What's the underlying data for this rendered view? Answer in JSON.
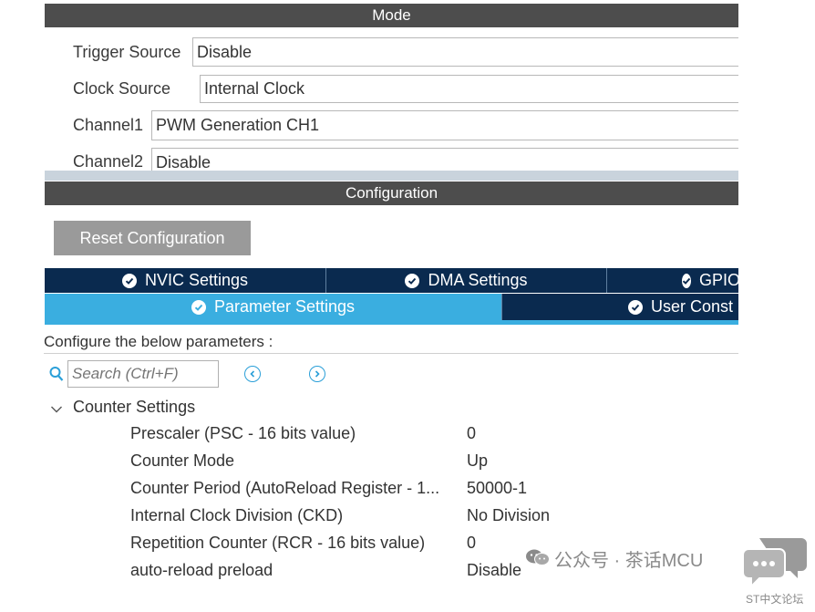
{
  "mode": {
    "title": "Mode",
    "rows": [
      {
        "label": "Trigger Source",
        "value": "Disable"
      },
      {
        "label": "Clock Source",
        "value": "Internal Clock"
      },
      {
        "label": "Channel1",
        "value": "PWM Generation CH1"
      },
      {
        "label": "Channel2",
        "value": "Disable"
      }
    ]
  },
  "configuration": {
    "title": "Configuration",
    "reset_label": "Reset Configuration",
    "tabs_row1": [
      "NVIC Settings",
      "DMA Settings",
      "GPIO"
    ],
    "tabs_row2": [
      "Parameter Settings",
      "User Const"
    ],
    "hint": "Configure the below parameters :",
    "search_placeholder": "Search (Ctrl+F)"
  },
  "counter_settings": {
    "group_label": "Counter Settings",
    "params": [
      {
        "name": "Prescaler (PSC - 16 bits value)",
        "value": "0"
      },
      {
        "name": "Counter Mode",
        "value": "Up"
      },
      {
        "name": "Counter Period (AutoReload Register - 1...",
        "value": "50000-1"
      },
      {
        "name": "Internal Clock Division (CKD)",
        "value": "No Division"
      },
      {
        "name": "Repetition Counter (RCR - 16 bits value)",
        "value": "0"
      },
      {
        "name": "auto-reload preload",
        "value": "Disable"
      }
    ]
  },
  "watermark": {
    "text": "公众号 · 茶话MCU",
    "logo_caption": "ST中文论坛"
  },
  "colors": {
    "accent": "#3aaee0",
    "tab_dark": "#0a2a4f",
    "bar": "#4d4d4d",
    "icon_blue": "#2a9fd8"
  }
}
